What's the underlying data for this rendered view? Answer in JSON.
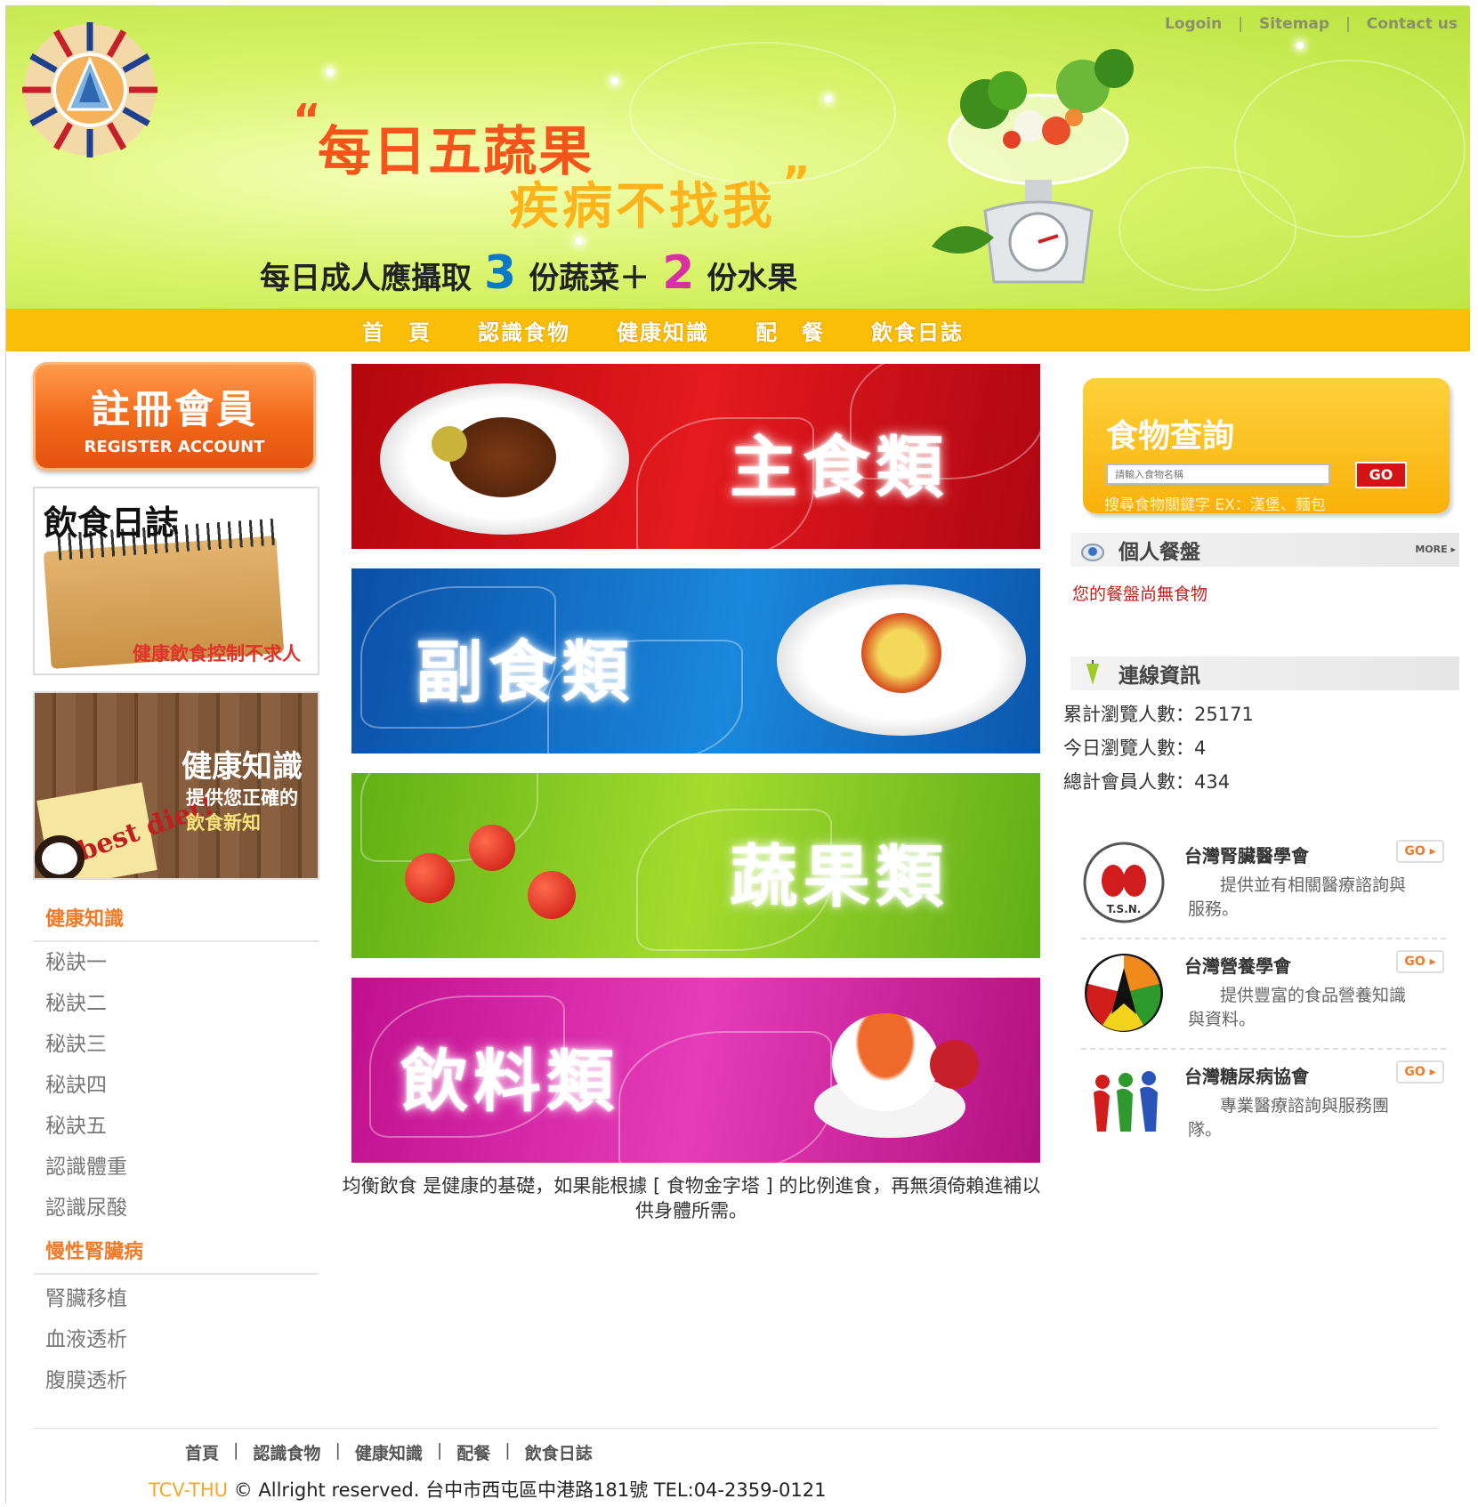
{
  "header": {
    "top_links": [
      "Logoin",
      "Sitemap",
      "Contact us"
    ],
    "slogan_line1": "每日五蔬果",
    "slogan_line2": "疾病不找我",
    "subline_part1": "每日成人應攝取",
    "subline_num1": "3",
    "subline_part2": "份蔬菜＋",
    "subline_num2": "2",
    "subline_part3": "份水果"
  },
  "nav": {
    "items": [
      "首　頁",
      "認識食物",
      "健康知識",
      "配　餐",
      "飲食日誌"
    ]
  },
  "left": {
    "register_title": "註冊會員",
    "register_subtitle": "REGISTER ACCOUNT",
    "diary_title": "飲食日誌",
    "diary_caption": "健康飲食控制不求人",
    "health_title": "健康知識",
    "health_line1": "提供您正確的",
    "health_line2": "飲食新知",
    "health_note": "best diet!",
    "section1_heading": "健康知識",
    "section1_items": [
      "秘訣一",
      "秘訣二",
      "秘訣三",
      "秘訣四",
      "秘訣五",
      "認識體重",
      "認識尿酸"
    ],
    "section2_heading": "慢性腎臟病",
    "section2_items": [
      "腎臟移植",
      "血液透析",
      "腹膜透析"
    ]
  },
  "center": {
    "banners": [
      "主食類",
      "副食類",
      "蔬果類",
      "飲料類"
    ],
    "caption": "均衡飲食 是健康的基礎，如果能根據 [ 食物金字塔 ] 的比例進食，再無須倚賴進補以供身體所需。"
  },
  "right": {
    "search_title": "食物查詢",
    "search_placeholder": "請輸入食物名稱",
    "search_button": "GO",
    "search_hint": "搜尋食物關鍵字 EX：漢堡、麵包",
    "plate_title": "個人餐盤",
    "plate_more": "MORE ▸",
    "plate_empty": "您的餐盤尚無食物",
    "conn_title": "連線資訊",
    "stats": [
      {
        "label": "累計瀏覽人數：",
        "value": "25171"
      },
      {
        "label": "今日瀏覽人數：",
        "value": "4"
      },
      {
        "label": "總計會員人數：",
        "value": "434"
      }
    ],
    "orgs": [
      {
        "name": "台灣腎臟醫學會",
        "go": "GO ▸",
        "desc": "提供並有相關醫療諮詢與服務。",
        "logo_text": "T.S.N."
      },
      {
        "name": "台灣營養學會",
        "go": "GO ▸",
        "desc": "提供豐富的食品營養知識與資料。"
      },
      {
        "name": "台灣糖尿病協會",
        "go": "GO ▸",
        "desc": "專業醫療諮詢與服務團隊。"
      }
    ]
  },
  "footer": {
    "nav": [
      "首頁",
      "認識食物",
      "健康知識",
      "配餐",
      "飲食日誌"
    ],
    "brand": "TCV-THU",
    "copyright": " © Allright reserved. 台中市西屯區中港路181號 TEL:04-2359-0121"
  },
  "colors": {
    "nav_bg": "#fbbe06",
    "accent_orange": "#f27b2a",
    "banner_red": "#e51a1e",
    "banner_blue": "#1a88dc",
    "banner_green": "#a5dc2e",
    "banner_magenta": "#e63cba"
  }
}
